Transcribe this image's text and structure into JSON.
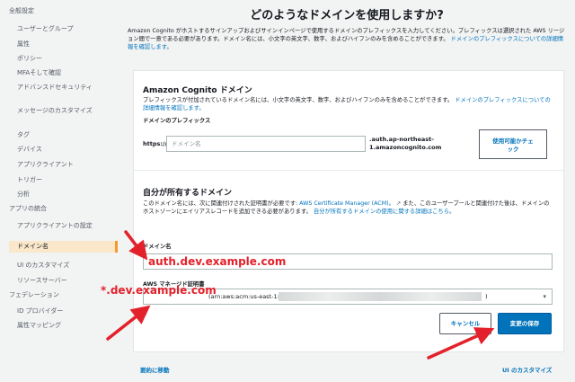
{
  "sidebar": {
    "items": [
      {
        "label": "全般設定",
        "level": 0
      },
      {
        "label": "ユーザーとグループ",
        "level": 1
      },
      {
        "label": "属性",
        "level": 1
      },
      {
        "label": "ポリシー",
        "level": 1
      },
      {
        "label": "MFAそして確認",
        "level": 1
      },
      {
        "label": "アドバンスドセキュリティ",
        "level": 1
      },
      {
        "label": "メッセージのカスタマイズ",
        "level": 1
      },
      {
        "label": "タグ",
        "level": 1
      },
      {
        "label": "デバイス",
        "level": 1
      },
      {
        "label": "アプリクライアント",
        "level": 1
      },
      {
        "label": "トリガー",
        "level": 1
      },
      {
        "label": "分析",
        "level": 1
      },
      {
        "label": "アプリの統合",
        "level": 0
      },
      {
        "label": "アプリクライアントの設定",
        "level": 1
      },
      {
        "label": "ドメイン名",
        "level": 1,
        "active": true
      },
      {
        "label": "UI のカスタマイズ",
        "level": 1
      },
      {
        "label": "リソースサーバー",
        "level": 1
      },
      {
        "label": "フェデレーション",
        "level": 0
      },
      {
        "label": "ID プロバイダー",
        "level": 1
      },
      {
        "label": "属性マッピング",
        "level": 1
      }
    ]
  },
  "page": {
    "title": "どのようなドメインを使用しますか?",
    "intro": "Amazon Cognito がホストするサインアップおよびサインインページで使用するドメインのプレフィックスを入力してください。プレフィックスは選択された AWS リージョン間で一意である必要があります。ドメイン名には、小文字の英文字、数字、およびハイフンのみを含めることができます。",
    "intro_link": "ドメインのプレフィックスについての詳細情報を確認します。"
  },
  "cognito_domain": {
    "title": "Amazon Cognito ドメイン",
    "desc": "プレフィックスが付加されているドメイン名には、小文字の英文字、数字、およびハイフンのみを含めることができます。",
    "desc_link": "ドメインのプレフィックスについての詳細情報を確認します。",
    "prefix_label": "ドメインのプレフィックス",
    "scheme": "https://",
    "prefix_placeholder": "ドメイン名",
    "suffix_line1": ".auth.ap-northeast-",
    "suffix_line2": "1.amazoncognito.com",
    "check_button_line1": "使用可能かチェ",
    "check_button_line2": "ック"
  },
  "custom_domain": {
    "title": "自分が所有するドメイン",
    "desc": "このドメイン名には、次に関連付けされた証明書が必要です:",
    "desc_acm_link": "AWS Certificate Manager (ACM)。",
    "desc_mid": "また、このユーザープールと関連付けた後は、ドメインのホストゾーンにエイリアスレコードを追加できる必要があります。",
    "desc_link2": "自分が所有するドメインの使用に関する詳細はこちら。",
    "domain_label": "ドメイン名",
    "domain_value": "auth.dev.example.com",
    "cert_label": "AWS マネージド証明書",
    "cert_value_prefix": "(arn:aws:acm:us-east-1:",
    "cert_value_suffix": ")"
  },
  "actions": {
    "cancel": "キャンセル",
    "save": "変更の保存"
  },
  "footer": {
    "back": "要約に移動",
    "next": "UI のカスタマイズ"
  },
  "annotations": {
    "cert_domain": "*.dev.example.com",
    "color": "#e3212b"
  }
}
